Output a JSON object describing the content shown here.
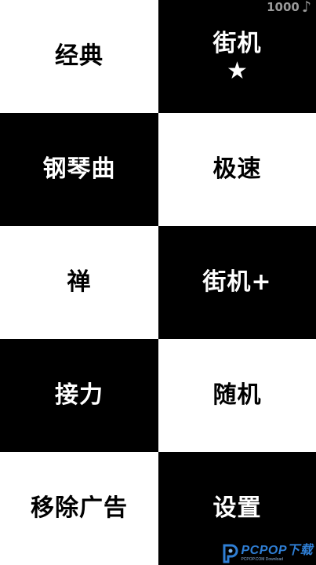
{
  "score": {
    "value": "1000",
    "icon": "music-note-icon"
  },
  "tiles": [
    {
      "label": "经典"
    },
    {
      "label": "街机",
      "badge_icon": "star-icon",
      "badge_glyph": "★"
    },
    {
      "label": "钢琴曲"
    },
    {
      "label": "极速"
    },
    {
      "label": "禅"
    },
    {
      "label": "街机+"
    },
    {
      "label": "接力"
    },
    {
      "label": "随机"
    },
    {
      "label": "移除广告"
    },
    {
      "label": "设置"
    }
  ],
  "watermark": {
    "main": "PCPOP下载",
    "sub": "PCPOP.COM Download"
  },
  "colors": {
    "dark_tile": "#000000",
    "light_tile": "#ffffff",
    "score_text": "#9a9a9a",
    "watermark_blue": "#2f7fd6"
  }
}
